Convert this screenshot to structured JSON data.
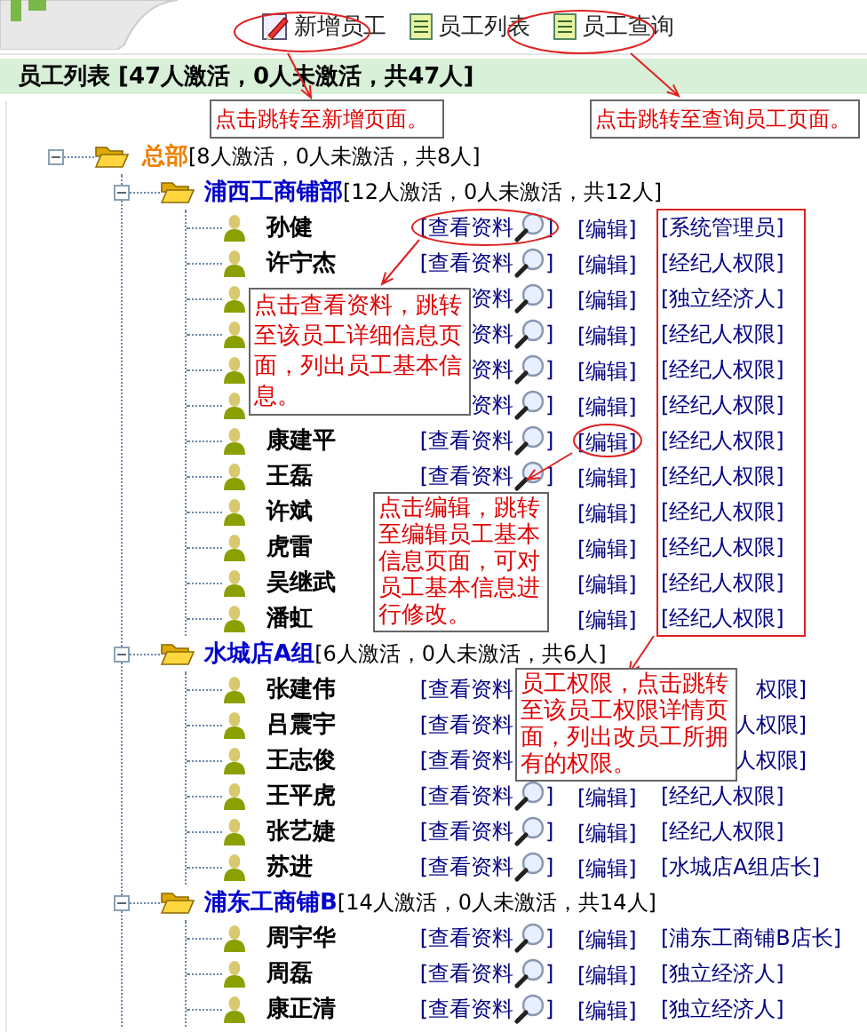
{
  "toolbar": [
    {
      "kind": "pencil",
      "label": "新增员工"
    },
    {
      "kind": "document",
      "label": "员工列表"
    },
    {
      "kind": "document",
      "label": "员工查询"
    }
  ],
  "title": "员工列表 [47人激活，0人未激活，共47人]",
  "tree": {
    "kind": "root",
    "name": "总部",
    "summary": "[8人激活，0人未激活，共8人]",
    "expanded": true,
    "children": [
      {
        "kind": "group",
        "name": "浦西工商铺部",
        "summary": "[12人激活，0人未激活，共12人]",
        "expanded": true,
        "children": [
          {
            "kind": "employee",
            "name": "孙健",
            "view": "[查看资料",
            "view_end": "]",
            "edit": "[编辑]",
            "role": "[系统管理员]"
          },
          {
            "kind": "employee",
            "name": "许宁杰",
            "view": "[查看资料",
            "view_end": "]",
            "edit": "[编辑]",
            "role": "[经纪人权限]"
          },
          {
            "kind": "employee",
            "view": "资料",
            "view_end": "]",
            "edit": "[编辑]",
            "role": "[独立经济人]"
          },
          {
            "kind": "employee",
            "view": "资料",
            "view_end": "]",
            "edit": "[编辑]",
            "role": "[经纪人权限]"
          },
          {
            "kind": "employee",
            "view": "资料",
            "view_end": "]",
            "edit": "[编辑]",
            "role": "[经纪人权限]"
          },
          {
            "kind": "employee",
            "view": "资料",
            "view_end": "]",
            "edit": "[编辑]",
            "role": "[经纪人权限]"
          },
          {
            "kind": "employee",
            "name": "康建平",
            "view": "[查看资料",
            "view_end": "]",
            "edit": "[编辑]",
            "role": "[经纪人权限]"
          },
          {
            "kind": "employee",
            "name": "王磊",
            "view": "[查看资料",
            "view_end": "]",
            "edit": "[编辑]",
            "role": "[经纪人权限]"
          },
          {
            "kind": "employee",
            "name": "许斌",
            "edit": "[编辑]",
            "role": "[经纪人权限]"
          },
          {
            "kind": "employee",
            "name": "虎雷",
            "edit": "[编辑]",
            "role": "[经纪人权限]"
          },
          {
            "kind": "employee",
            "name": "吴继武",
            "edit": "[编辑]",
            "role": "[经纪人权限]"
          },
          {
            "kind": "employee",
            "name": "潘虹",
            "edit": "[编辑]",
            "role": "[经纪人权限]"
          }
        ]
      },
      {
        "kind": "group",
        "name": "水城店A组",
        "summary": "[6人激活，0人未激活，共6人]",
        "expanded": true,
        "children": [
          {
            "kind": "employee",
            "name": "张建伟",
            "view": "[查看资料",
            "role": "权限]"
          },
          {
            "kind": "employee",
            "name": "吕震宇",
            "view": "[查看资料",
            "role": "人权限]"
          },
          {
            "kind": "employee",
            "name": "王志俊",
            "view": "[查看资料",
            "role": "人权限]"
          },
          {
            "kind": "employee",
            "name": "王平虎",
            "view": "[查看资料",
            "view_end": "]",
            "edit": "[编辑]",
            "role": "[经纪人权限]"
          },
          {
            "kind": "employee",
            "name": "张艺婕",
            "view": "[查看资料",
            "view_end": "]",
            "edit": "[编辑]",
            "role": "[经纪人权限]"
          },
          {
            "kind": "employee",
            "name": "苏进",
            "view": "[查看资料",
            "view_end": "]",
            "edit": "[编辑]",
            "role": "[水城店A组店长]"
          }
        ]
      },
      {
        "kind": "group",
        "name": "浦东工商铺B",
        "summary": "[14人激活，0人未激活，共14人]",
        "expanded": true,
        "children": [
          {
            "kind": "employee",
            "name": "周宇华",
            "view": "[查看资料",
            "view_end": "]",
            "edit": "[编辑]",
            "role": "[浦东工商铺B店长]"
          },
          {
            "kind": "employee",
            "name": "周磊",
            "view": "[查看资料",
            "view_end": "]",
            "edit": "[编辑]",
            "role": "[独立经济人]"
          },
          {
            "kind": "employee",
            "name": "康正清",
            "view": "[查看资料",
            "view_end": "]",
            "edit": "[编辑]",
            "role": "[独立经济人]"
          }
        ]
      }
    ]
  },
  "callouts": [
    {
      "text": "点击跳转至新增页面。"
    },
    {
      "text": "点击跳转至查询员工页面。"
    },
    {
      "text": "点击查看资料，跳转至该员工详细信息页面，列出员工基本信息。"
    },
    {
      "text": "点击编辑，跳转至编辑员工基本信息页面，可对员工基本信息进行修改。"
    },
    {
      "text": "员工权限，点击跳转至该员工权限详情页面，列出改员工所拥有的权限。"
    }
  ]
}
